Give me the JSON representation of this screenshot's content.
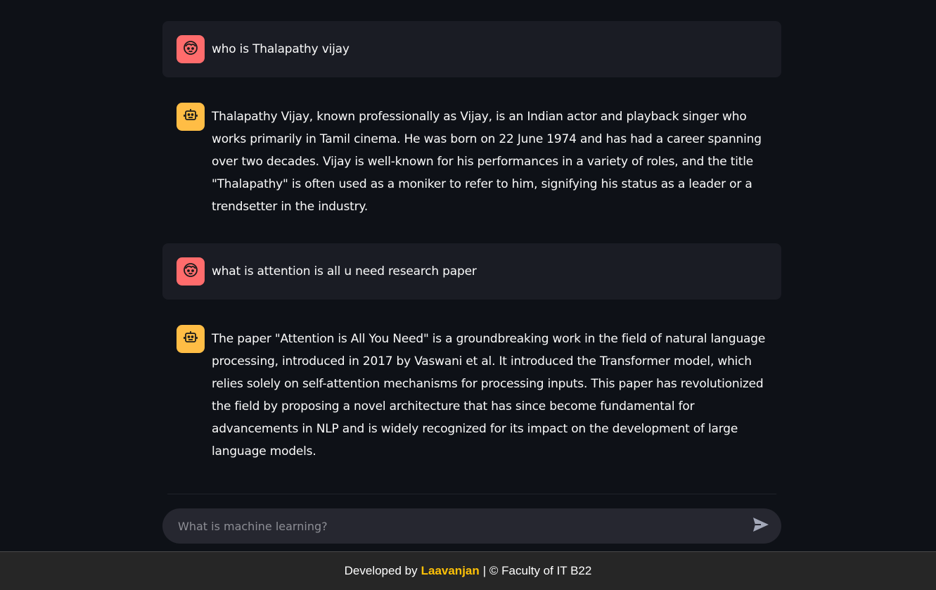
{
  "messages": [
    {
      "role": "user",
      "avatar_icon": "user-face-icon",
      "text": "who is Thalapathy vijay"
    },
    {
      "role": "assistant",
      "avatar_icon": "robot-icon",
      "text": "Thalapathy Vijay, known professionally as Vijay, is an Indian actor and playback singer who works primarily in Tamil cinema. He was born on 22 June 1974 and has had a career spanning over two decades. Vijay is well-known for his performances in a variety of roles, and the title \"Thalapathy\" is often used as a moniker to refer to him, signifying his status as a leader or a trendsetter in the industry."
    },
    {
      "role": "user",
      "avatar_icon": "user-face-icon",
      "text": "what is attention is all u need research paper"
    },
    {
      "role": "assistant",
      "avatar_icon": "robot-icon",
      "text": "The paper \"Attention is All You Need\" is a groundbreaking work in the field of natural language processing, introduced in 2017 by Vaswani et al. It introduced the Transformer model, which relies solely on self-attention mechanisms for processing inputs. This paper has revolutionized the field by proposing a novel architecture that has since become fundamental for advancements in NLP and is widely recognized for its impact on the development of large language models."
    }
  ],
  "chat_input": {
    "placeholder": "What is machine learning?",
    "value": "",
    "send_icon": "send-icon"
  },
  "footer": {
    "prefix": "Developed by",
    "author": "Laavanjan",
    "suffix": "| © Faculty of IT B22"
  },
  "colors": {
    "background": "#0e1117",
    "user_bubble": "#1a1c24",
    "user_avatar": "#ff6c6c",
    "assistant_avatar": "#ffbd45",
    "input_bg": "#262730",
    "footer_bg": "#262626",
    "footer_accent": "#ffc107"
  }
}
